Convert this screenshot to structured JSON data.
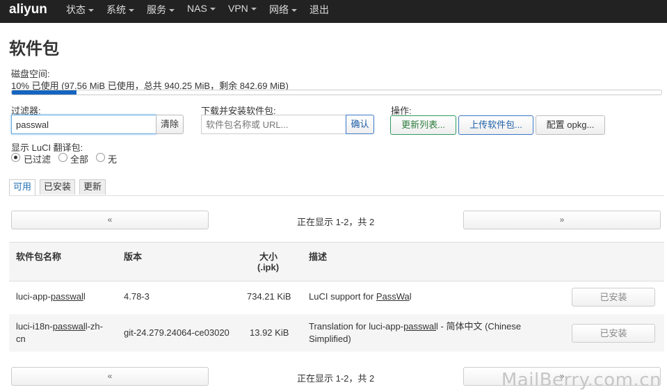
{
  "nav": {
    "brand": "aliyun",
    "menu": [
      {
        "label": "状态",
        "dropdown": true
      },
      {
        "label": "系统",
        "dropdown": true
      },
      {
        "label": "服务",
        "dropdown": true
      },
      {
        "label": "NAS",
        "dropdown": true
      },
      {
        "label": "VPN",
        "dropdown": true
      },
      {
        "label": "网络",
        "dropdown": true
      },
      {
        "label": "退出",
        "dropdown": false
      }
    ]
  },
  "page": {
    "title": "软件包"
  },
  "disk": {
    "label": "磁盘空间:",
    "usage_text": "10% 已使用 (97.56 MiB 已使用，总共 940.25 MiB，剩余 842.69 MiB)",
    "percent": 10
  },
  "filter": {
    "label": "过滤器:",
    "value": "passwal",
    "clear_label": "清除"
  },
  "download": {
    "label": "下载并安装软件包:",
    "placeholder": "软件包名称或 URL...",
    "confirm_label": "确认"
  },
  "actions": {
    "label": "操作:",
    "update_label": "更新列表...",
    "upload_label": "上传软件包...",
    "config_label": "配置 opkg..."
  },
  "luci": {
    "label": "显示 LuCI 翻译包:",
    "options": [
      "已过滤",
      "全部",
      "无"
    ],
    "selected": "已过滤"
  },
  "tabs": [
    {
      "label": "可用",
      "active": true
    },
    {
      "label": "已安装",
      "active": false
    },
    {
      "label": "更新",
      "active": false
    }
  ],
  "pager": {
    "prev": "«",
    "next": "»",
    "status": "正在显示 1-2，共 2"
  },
  "table": {
    "headers": {
      "name": "软件包名称",
      "version": "版本",
      "size_line1": "大小",
      "size_line2": "(.ipk)",
      "description": "描述"
    },
    "rows": [
      {
        "name_pre": "luci-app-",
        "name_hl": "passwal",
        "name_post": "l",
        "name_line2": "",
        "version": "4.78-3",
        "size": "734.21 KiB",
        "desc_pre": "LuCI support for ",
        "desc_hl": "PassWa",
        "desc_post": "l",
        "desc_line2": "",
        "action": "已安装"
      },
      {
        "name_pre": "luci-i18n-",
        "name_hl": "passwal",
        "name_post": "l-zh-",
        "name_line2": "cn",
        "version": "git-24.279.24064-ce03020",
        "size": "13.92 KiB",
        "desc_pre": "Translation for luci-app-",
        "desc_hl": "passwal",
        "desc_post": "l - 简体中文 (Chinese",
        "desc_line2": "Simplified)",
        "action": "已安装"
      }
    ]
  },
  "watermark": "MailBerry.com.cn"
}
